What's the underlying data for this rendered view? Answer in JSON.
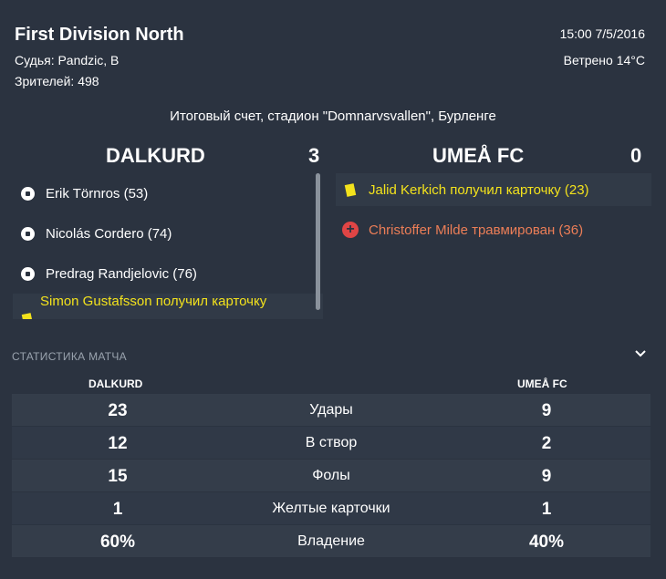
{
  "header": {
    "competition": "First Division North",
    "referee": "Судья: Pandzic, B",
    "attendance": "Зрителей: 498",
    "datetime": "15:00 7/5/2016",
    "weather": "Ветрено 14°C"
  },
  "result_line": "Итоговый счет, стадион \"Domnarvsvallen\", Бурленге",
  "home": {
    "name": "DALKURD",
    "score": "3",
    "events": [
      {
        "type": "goal",
        "icon": "soccer-ball-icon",
        "text": "Erik Törnros (53)"
      },
      {
        "type": "goal",
        "icon": "soccer-ball-icon",
        "text": "Nicolás Cordero (74)"
      },
      {
        "type": "goal",
        "icon": "soccer-ball-icon",
        "text": "Predrag Randjelovic (76)"
      },
      {
        "type": "card",
        "icon": "yellow-card-icon",
        "text": "Simon Gustafsson получил карточку"
      }
    ]
  },
  "away": {
    "name": "UMEÅ FC",
    "score": "0",
    "events": [
      {
        "type": "card",
        "icon": "yellow-card-icon",
        "text": "Jalid Kerkich получил карточку (23)"
      },
      {
        "type": "injury",
        "icon": "injury-cross-icon",
        "text": "Christoffer Milde травмирован (36)"
      }
    ]
  },
  "stats": {
    "title": "СТАТИСТИКА МАТЧА",
    "home_label": "DALKURD",
    "away_label": "UMEÅ FC",
    "rows": [
      {
        "home": "23",
        "label": "Удары",
        "away": "9"
      },
      {
        "home": "12",
        "label": "В створ",
        "away": "2"
      },
      {
        "home": "15",
        "label": "Фолы",
        "away": "9"
      },
      {
        "home": "1",
        "label": "Желтые карточки",
        "away": "1"
      },
      {
        "home": "60%",
        "label": "Владение",
        "away": "40%"
      }
    ]
  },
  "colors": {
    "background": "#2b3340",
    "card_text": "#f3e21c",
    "injury_text": "#ec7e57",
    "injury_icon": "#e04545"
  }
}
